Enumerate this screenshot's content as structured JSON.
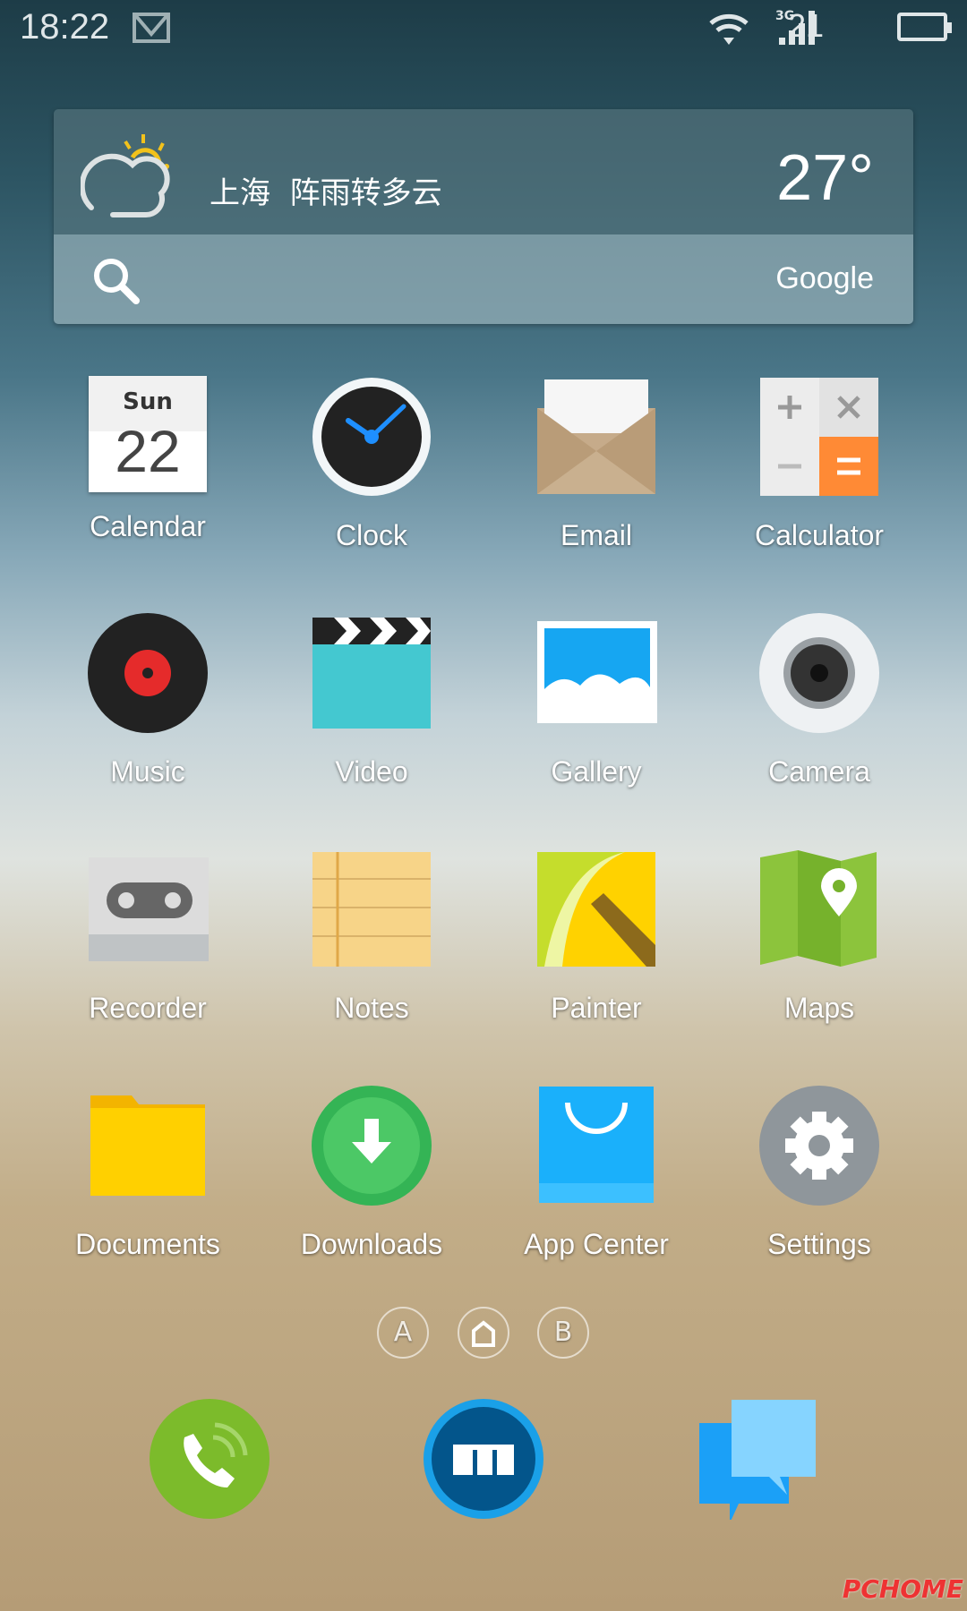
{
  "status_bar": {
    "time": "18:22",
    "signal_label": "3G",
    "signal_strength": "21",
    "icons": [
      "mail-icon",
      "wifi-icon",
      "signal-icon",
      "battery-icon"
    ]
  },
  "weather_widget": {
    "city": "上海",
    "condition": "阵雨转多云",
    "temperature": "27°",
    "search_provider": "Google",
    "icons": [
      "partly-cloudy-icon",
      "search-icon"
    ]
  },
  "apps": [
    {
      "label": "Calendar",
      "day": "Sun",
      "date": "22"
    },
    {
      "label": "Clock"
    },
    {
      "label": "Email"
    },
    {
      "label": "Calculator"
    },
    {
      "label": "Music"
    },
    {
      "label": "Video"
    },
    {
      "label": "Gallery"
    },
    {
      "label": "Camera"
    },
    {
      "label": "Recorder"
    },
    {
      "label": "Notes"
    },
    {
      "label": "Painter"
    },
    {
      "label": "Maps"
    },
    {
      "label": "Documents"
    },
    {
      "label": "Downloads"
    },
    {
      "label": "App Center"
    },
    {
      "label": "Settings"
    }
  ],
  "page_indicator": {
    "left": "A",
    "right": "B",
    "current": "home"
  },
  "dock": [
    "phone",
    "browser",
    "messages"
  ],
  "watermark": "PCHOME"
}
